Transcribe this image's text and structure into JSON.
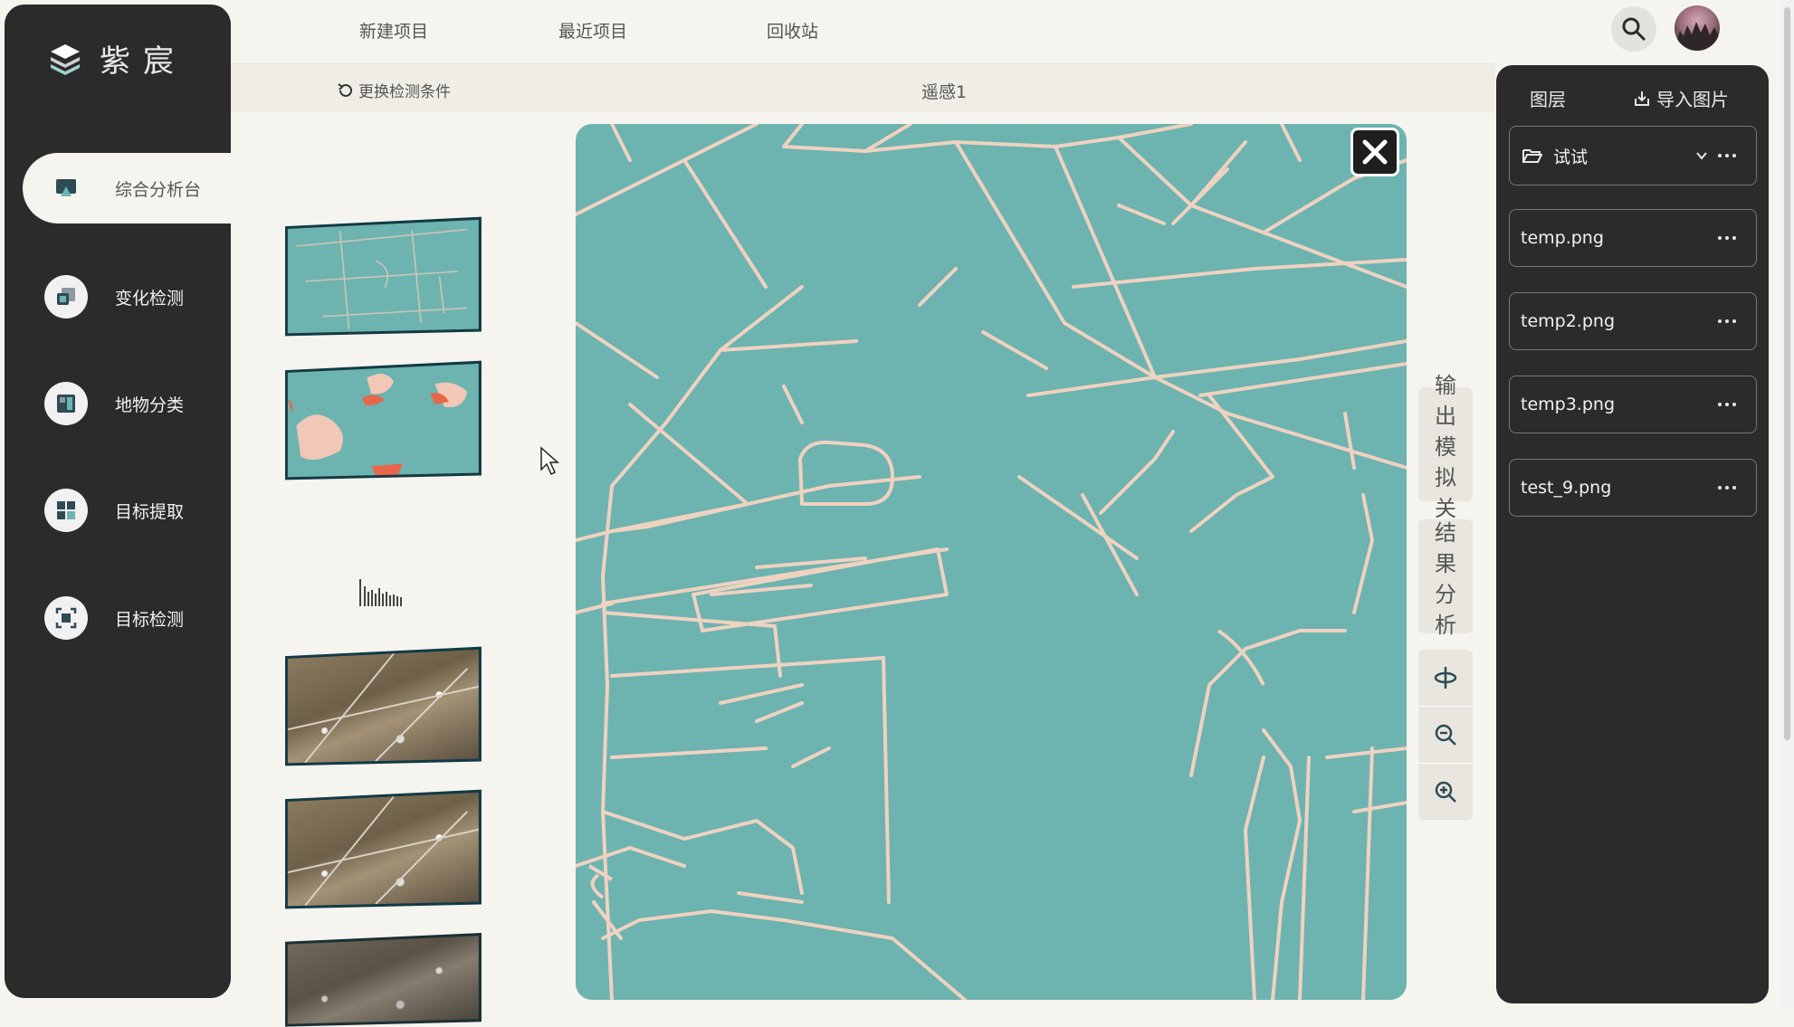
{
  "app": {
    "brand": "紫宸"
  },
  "sidebar": {
    "items": [
      {
        "label": "综合分析台",
        "icon": "monitor-icon",
        "active": true
      },
      {
        "label": "变化检测",
        "icon": "change-detect-icon",
        "active": false
      },
      {
        "label": "地物分类",
        "icon": "classify-icon",
        "active": false
      },
      {
        "label": "目标提取",
        "icon": "extract-grid-icon",
        "active": false
      },
      {
        "label": "目标检测",
        "icon": "detect-frame-icon",
        "active": false
      }
    ]
  },
  "top_menu": {
    "new_project": "新建项目",
    "recent_projects": "最近项目",
    "recycle_bin": "回收站"
  },
  "toolbar": {
    "change_condition": "更换检测条件",
    "title": "遥感1"
  },
  "tools": {
    "export": "输出模拟关",
    "result": "结果分析",
    "pan": "pan-icon",
    "zoom_out": "zoom-out-icon",
    "zoom_in": "zoom-in-icon"
  },
  "layers": {
    "title": "图层",
    "import_label": "导入图片",
    "folder": {
      "name": "试试",
      "icon": "folder-open-icon"
    },
    "files": [
      "temp.png",
      "temp2.png",
      "temp3.png",
      "test_9.png"
    ]
  },
  "colors": {
    "sidebar_bg": "#2b2b2b",
    "map_bg": "#6db3b0",
    "road": "#efd2c0",
    "page_bg": "#f6f4ee",
    "highlight": "#e8674a"
  }
}
